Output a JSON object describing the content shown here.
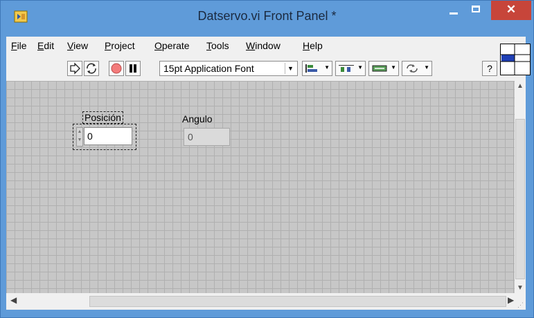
{
  "window": {
    "title": "Datservo.vi Front Panel *",
    "close_glyph": "✕",
    "accent": "#5f9bd9",
    "close_color": "#c7453a"
  },
  "menu": {
    "items": [
      {
        "mnemonic": "F",
        "rest": "ile"
      },
      {
        "mnemonic": "E",
        "rest": "dit"
      },
      {
        "mnemonic": "V",
        "rest": "iew"
      },
      {
        "mnemonic": "P",
        "rest": "roject"
      },
      {
        "mnemonic": "O",
        "rest": "perate"
      },
      {
        "mnemonic": "T",
        "rest": "ools"
      },
      {
        "mnemonic": "W",
        "rest": "indow"
      },
      {
        "mnemonic": "H",
        "rest": "elp"
      }
    ]
  },
  "toolbar": {
    "font": "15pt Application Font",
    "run_icon": "run-arrow-icon",
    "run_continuous_icon": "run-continuously-icon",
    "abort_icon": "abort-icon",
    "pause_icon": "pause-icon",
    "align_icon": "align-objects-icon",
    "distribute_icon": "distribute-objects-icon",
    "resize_icon": "resize-objects-icon",
    "reorder_icon": "reorder-icon",
    "help_glyph": "?"
  },
  "panel": {
    "controls": [
      {
        "label": "Posición",
        "value": "0"
      },
      {
        "label": "Angulo",
        "value": "0"
      }
    ]
  }
}
